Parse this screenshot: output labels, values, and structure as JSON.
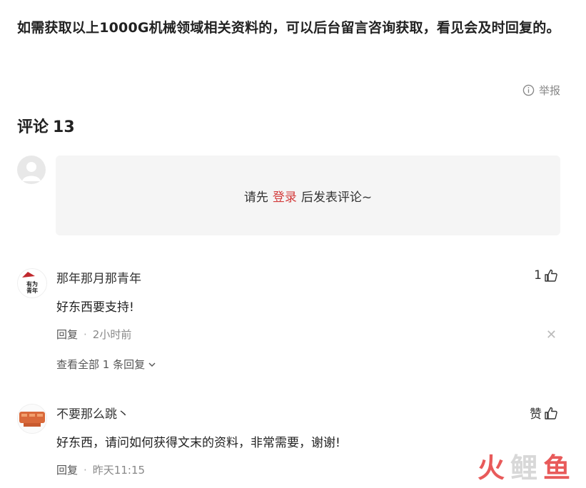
{
  "article": {
    "text": "如需获取以上1000G机械领域相关资料的，可以后台留言咨询获取，看见会及时回复的。"
  },
  "report": {
    "label": "举报"
  },
  "comments_section": {
    "title_label": "评论",
    "count": "13",
    "login_prompt": {
      "before": "请先",
      "link": "登录",
      "after": "后发表评论~"
    }
  },
  "comments": [
    {
      "user": "那年那月那青年",
      "avatar_text": "有为青年",
      "likes": "1",
      "body": "好东西要支持!",
      "reply_label": "回复",
      "time": "2小时前",
      "more_replies": "查看全部 1 条回复"
    },
    {
      "user": "不要那么跳丶",
      "likes_label": "赞",
      "body": "好东西，请问如何获得文末的资料，非常需要，谢谢!",
      "reply_label": "回复",
      "time": "昨天11:15"
    }
  ],
  "watermark": {
    "chars": [
      "火",
      "鲤",
      "鱼"
    ]
  },
  "colors": {
    "accent_red": "#d33c3c",
    "watermark_red": "#e85a5a",
    "watermark_gray": "#d8d8d8"
  }
}
